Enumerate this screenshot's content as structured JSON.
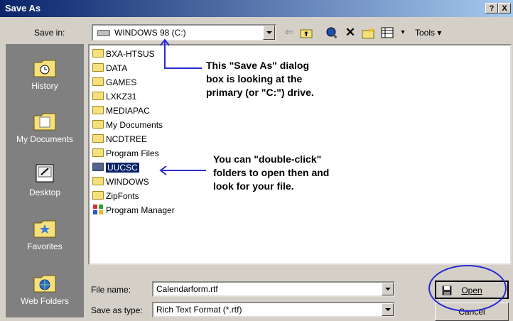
{
  "window": {
    "title": "Save As",
    "help_glyph": "?",
    "close_glyph": "X"
  },
  "save_in": {
    "label": "Save in:",
    "value": "WINDOWS 98 (C:)"
  },
  "toolbar": {
    "tools_label": "Tools",
    "icons": [
      "back-arrow-icon",
      "up-folder-icon",
      "search-web-icon",
      "delete-icon",
      "new-folder-icon",
      "views-icon"
    ]
  },
  "places": [
    {
      "label": "History",
      "icon": "history-icon"
    },
    {
      "label": "My Documents",
      "icon": "my-documents-icon"
    },
    {
      "label": "Desktop",
      "icon": "desktop-icon"
    },
    {
      "label": "Favorites",
      "icon": "favorites-icon"
    },
    {
      "label": "Web Folders",
      "icon": "web-folders-icon"
    }
  ],
  "files": [
    {
      "name": "BXA-HTSUS",
      "icon": "folder-icon"
    },
    {
      "name": "DATA",
      "icon": "folder-icon"
    },
    {
      "name": "GAMES",
      "icon": "folder-icon"
    },
    {
      "name": "LXKZ31",
      "icon": "folder-icon"
    },
    {
      "name": "MEDIAPAC",
      "icon": "folder-icon"
    },
    {
      "name": "My Documents",
      "icon": "my-documents-folder-icon"
    },
    {
      "name": "NCDTREE",
      "icon": "folder-icon"
    },
    {
      "name": "Program Files",
      "icon": "folder-icon"
    },
    {
      "name": "UUCSC",
      "icon": "folder-icon",
      "selected": true
    },
    {
      "name": "WINDOWS",
      "icon": "folder-icon"
    },
    {
      "name": "ZipFonts",
      "icon": "folder-icon"
    },
    {
      "name": "Program Manager",
      "icon": "program-manager-icon"
    }
  ],
  "annotations": {
    "drive_lines": [
      "This \"Save As\" dialog",
      "box is looking at the",
      "primary (or \"C:\") drive."
    ],
    "folder_lines": [
      "You can \"double-click\"",
      "folders to open then and",
      "look for your file."
    ]
  },
  "file_name": {
    "label": "File name:",
    "value": "Calendarform.rtf"
  },
  "save_as_type": {
    "label": "Save as type:",
    "value": "Rich Text Format (*.rtf)"
  },
  "buttons": {
    "open": "Open",
    "cancel": "Cancel"
  },
  "colors": {
    "title_start": "#0a246a",
    "title_end": "#a6caf0",
    "selection": "#0a246a",
    "annotation_line": "#2a2ad0"
  }
}
